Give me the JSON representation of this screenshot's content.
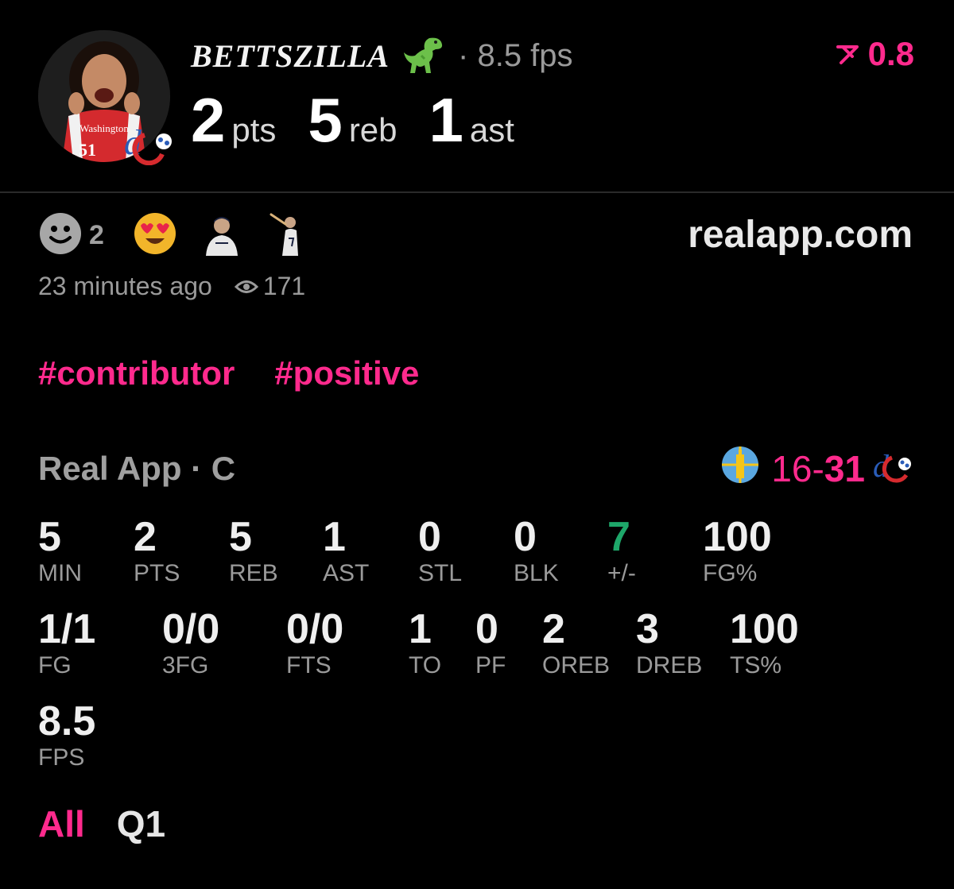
{
  "player": {
    "name": "BETTSZILLA",
    "badge_icon": "dinosaur-emoji",
    "fps_inline": "· 8.5 fps",
    "jersey_text": "Washington",
    "jersey_number": "51",
    "delta": "0.8",
    "delta_icon": "trend-down-arrow-icon",
    "stats": [
      {
        "value": "2",
        "unit": "pts"
      },
      {
        "value": "5",
        "unit": "reb"
      },
      {
        "value": "1",
        "unit": "ast"
      }
    ]
  },
  "reactions": {
    "smile_count": "2",
    "items": [
      "smile-icon",
      "heart-eyes-emoji",
      "player-avatar-1",
      "player-avatar-2"
    ]
  },
  "site": "realapp.com",
  "meta": {
    "time": "23 minutes ago",
    "views": "171"
  },
  "tags": [
    "#contributor",
    "#positive"
  ],
  "game": {
    "title": "Real App · C",
    "home_score": "16",
    "separator": "-",
    "away_score": "31"
  },
  "stat_rows": {
    "row1": [
      {
        "value": "5",
        "label": "MIN"
      },
      {
        "value": "2",
        "label": "PTS"
      },
      {
        "value": "5",
        "label": "REB"
      },
      {
        "value": "1",
        "label": "AST"
      },
      {
        "value": "0",
        "label": "STL"
      },
      {
        "value": "0",
        "label": "BLK"
      },
      {
        "value": "7",
        "label": "+/-"
      },
      {
        "value": "100",
        "label": "FG%"
      }
    ],
    "row2": [
      {
        "value": "1/1",
        "label": "FG"
      },
      {
        "value": "0/0",
        "label": "3FG"
      },
      {
        "value": "0/0",
        "label": "FTS"
      },
      {
        "value": "1",
        "label": "TO"
      },
      {
        "value": "0",
        "label": "PF"
      },
      {
        "value": "2",
        "label": "OREB"
      },
      {
        "value": "3",
        "label": "DREB"
      },
      {
        "value": "100",
        "label": "TS%"
      }
    ],
    "row3": [
      {
        "value": "8.5",
        "label": "FPS"
      }
    ]
  },
  "tabs": [
    {
      "label": "All",
      "active": true
    },
    {
      "label": "Q1",
      "active": false
    }
  ],
  "colors": {
    "accent": "#ff2a8d",
    "positive": "#1ea76a",
    "muted": "#9a9a9a"
  }
}
